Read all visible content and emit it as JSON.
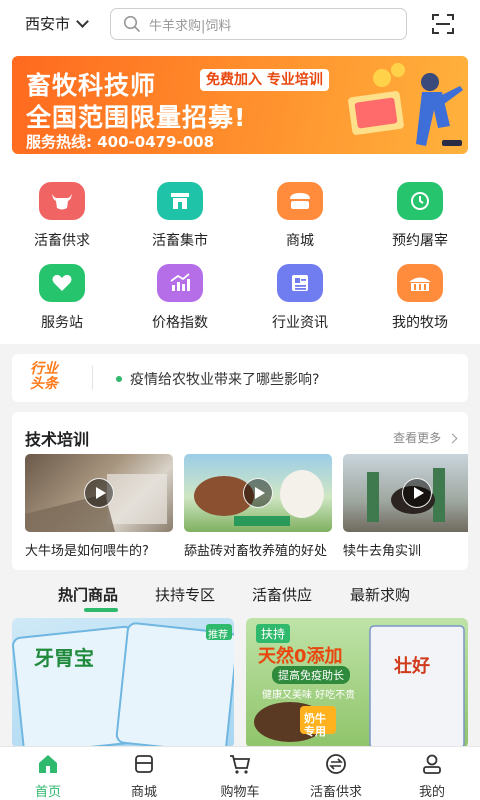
{
  "header": {
    "city": "西安市",
    "search_placeholder": "牛羊求购|饲料"
  },
  "banner": {
    "title_line1": "畜牧科技师",
    "tag": "免费加入 专业培训",
    "title_line2": "全国范围限量招募!",
    "phone": "服务热线: 400-0479-008"
  },
  "categories": [
    {
      "label": "活畜供求",
      "icon": "bull-icon",
      "color": "#f06464"
    },
    {
      "label": "活畜集市",
      "icon": "market-icon",
      "color": "#1fc3a8"
    },
    {
      "label": "商城",
      "icon": "store-icon",
      "color": "#ff8b3d"
    },
    {
      "label": "预约屠宰",
      "icon": "clock-icon",
      "color": "#27c46e"
    },
    {
      "label": "服务站",
      "icon": "heart-icon",
      "color": "#27c46e"
    },
    {
      "label": "价格指数",
      "icon": "chart-icon",
      "color": "#b56ee8"
    },
    {
      "label": "行业资讯",
      "icon": "news-icon",
      "color": "#6f7df0"
    },
    {
      "label": "我的牧场",
      "icon": "farm-icon",
      "color": "#ff8b3d"
    }
  ],
  "news": {
    "tag_line1": "行业",
    "tag_line2": "头条",
    "headline": "疫情给农牧业带来了哪些影响?"
  },
  "training": {
    "title": "技术培训",
    "more": "查看更多",
    "videos": [
      {
        "caption": "大牛场是如何喂牛的?"
      },
      {
        "caption": "舔盐砖对畜牧养殖的好处"
      },
      {
        "caption": "犊牛去角实训"
      }
    ]
  },
  "tabs": [
    "热门商品",
    "扶持专区",
    "活畜供应",
    "最新求购"
  ],
  "products": {
    "left_brand": "牙胃宝",
    "left_badge": "推荐",
    "right_badge": "扶持",
    "right_title": "天然0添加",
    "right_sub1": "提高免疫助长",
    "right_sub2": "健康又美味 好吃不贵",
    "right_sub3": "奶牛专用",
    "right_bag": "壮好"
  },
  "bottom_nav": [
    {
      "label": "首页",
      "icon": "home-icon",
      "active": true
    },
    {
      "label": "商城",
      "icon": "shop-icon",
      "active": false
    },
    {
      "label": "购物车",
      "icon": "cart-icon",
      "active": false
    },
    {
      "label": "活畜供求",
      "icon": "exchange-icon",
      "active": false
    },
    {
      "label": "我的",
      "icon": "user-icon",
      "active": false
    }
  ],
  "colors": {
    "accent": "#2fb96c",
    "banner": "#ff7a22"
  }
}
